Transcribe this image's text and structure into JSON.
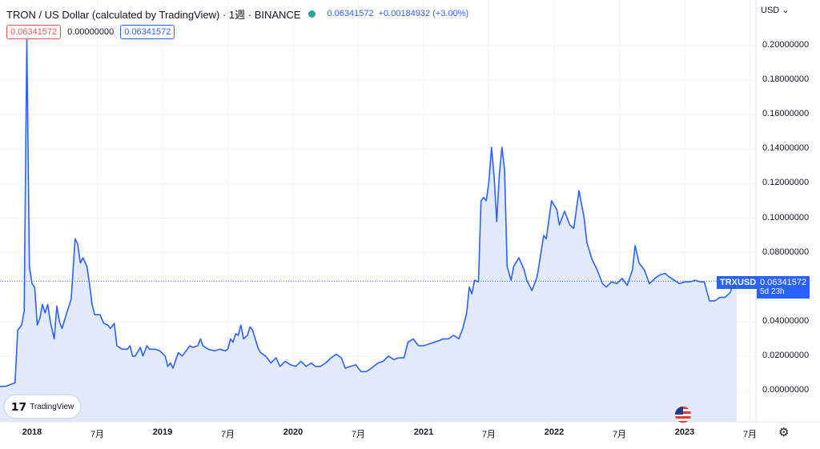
{
  "header": {
    "title": "TRON / US Dollar (calculated by TradingView) · 1週 · BINANCE",
    "last_price": "0.06341572",
    "change": "+0.00184932 (+3.00%)"
  },
  "values_row": {
    "low": "0.06341572",
    "mid": "0.00000000",
    "close": "0.06341572"
  },
  "currency_button": "USD",
  "ticker_label": "TRXUSD",
  "price_label": {
    "price": "0.06341572",
    "countdown": "5d 23h"
  },
  "logo_text": "TradingView",
  "colors": {
    "line": "#2962ff",
    "fill": "#dde6fb",
    "grid": "#f0f3fa"
  },
  "chart_data": {
    "type": "area",
    "title": "TRON / US Dollar (calculated by TradingView) · 1週 · BINANCE",
    "xlabel": "",
    "ylabel": "",
    "ylim": [
      -0.005,
      0.205
    ],
    "grid": true,
    "x_ticks": [
      {
        "label": "2018",
        "t": 2018.0,
        "bold": true
      },
      {
        "label": "7月",
        "t": 2018.5,
        "bold": false
      },
      {
        "label": "2019",
        "t": 2019.0,
        "bold": true
      },
      {
        "label": "7月",
        "t": 2019.5,
        "bold": false
      },
      {
        "label": "2020",
        "t": 2020.0,
        "bold": true
      },
      {
        "label": "7月",
        "t": 2020.5,
        "bold": false
      },
      {
        "label": "2021",
        "t": 2021.0,
        "bold": true
      },
      {
        "label": "7月",
        "t": 2021.5,
        "bold": false
      },
      {
        "label": "2022",
        "t": 2022.0,
        "bold": true
      },
      {
        "label": "7月",
        "t": 2022.5,
        "bold": false
      },
      {
        "label": "2023",
        "t": 2023.0,
        "bold": true
      },
      {
        "label": "7月",
        "t": 2023.5,
        "bold": false
      }
    ],
    "y_ticks": [
      {
        "label": "0.00000000",
        "v": 0.0
      },
      {
        "label": "0.02000000",
        "v": 0.02
      },
      {
        "label": "0.04000000",
        "v": 0.04
      },
      {
        "label": "0.06000000",
        "v": 0.06
      },
      {
        "label": "0.08000000",
        "v": 0.08
      },
      {
        "label": "0.10000000",
        "v": 0.1
      },
      {
        "label": "0.12000000",
        "v": 0.12
      },
      {
        "label": "0.14000000",
        "v": 0.14
      },
      {
        "label": "0.16000000",
        "v": 0.16
      },
      {
        "label": "0.18000000",
        "v": 0.18
      },
      {
        "label": "0.20000000",
        "v": 0.2
      }
    ],
    "series": [
      {
        "name": "TRXUSD",
        "points": [
          [
            2017.72,
            0.0023
          ],
          [
            2017.8,
            0.0025
          ],
          [
            2017.87,
            0.0045
          ],
          [
            2017.89,
            0.035
          ],
          [
            2017.92,
            0.038
          ],
          [
            2017.94,
            0.046
          ],
          [
            2017.96,
            0.205
          ],
          [
            2017.98,
            0.072
          ],
          [
            2018.0,
            0.062
          ],
          [
            2018.02,
            0.06
          ],
          [
            2018.04,
            0.038
          ],
          [
            2018.06,
            0.042
          ],
          [
            2018.08,
            0.05
          ],
          [
            2018.1,
            0.045
          ],
          [
            2018.12,
            0.05
          ],
          [
            2018.14,
            0.04
          ],
          [
            2018.17,
            0.03
          ],
          [
            2018.19,
            0.049
          ],
          [
            2018.21,
            0.04
          ],
          [
            2018.23,
            0.036
          ],
          [
            2018.27,
            0.046
          ],
          [
            2018.3,
            0.053
          ],
          [
            2018.33,
            0.088
          ],
          [
            2018.35,
            0.085
          ],
          [
            2018.37,
            0.074
          ],
          [
            2018.39,
            0.077
          ],
          [
            2018.42,
            0.072
          ],
          [
            2018.44,
            0.062
          ],
          [
            2018.46,
            0.05
          ],
          [
            2018.48,
            0.044
          ],
          [
            2018.52,
            0.044
          ],
          [
            2018.55,
            0.039
          ],
          [
            2018.58,
            0.038
          ],
          [
            2018.6,
            0.036
          ],
          [
            2018.63,
            0.039
          ],
          [
            2018.65,
            0.026
          ],
          [
            2018.69,
            0.024
          ],
          [
            2018.73,
            0.024
          ],
          [
            2018.75,
            0.026
          ],
          [
            2018.77,
            0.02
          ],
          [
            2018.79,
            0.02
          ],
          [
            2018.83,
            0.025
          ],
          [
            2018.85,
            0.02
          ],
          [
            2018.88,
            0.026
          ],
          [
            2018.9,
            0.024
          ],
          [
            2018.94,
            0.024
          ],
          [
            2018.98,
            0.023
          ],
          [
            2019.02,
            0.02
          ],
          [
            2019.04,
            0.014
          ],
          [
            2019.06,
            0.016
          ],
          [
            2019.08,
            0.013
          ],
          [
            2019.12,
            0.022
          ],
          [
            2019.15,
            0.02
          ],
          [
            2019.19,
            0.024
          ],
          [
            2019.21,
            0.026
          ],
          [
            2019.23,
            0.025
          ],
          [
            2019.27,
            0.026
          ],
          [
            2019.29,
            0.03
          ],
          [
            2019.31,
            0.026
          ],
          [
            2019.35,
            0.024
          ],
          [
            2019.4,
            0.023
          ],
          [
            2019.44,
            0.024
          ],
          [
            2019.48,
            0.023
          ],
          [
            2019.5,
            0.024
          ],
          [
            2019.52,
            0.03
          ],
          [
            2019.54,
            0.028
          ],
          [
            2019.56,
            0.033
          ],
          [
            2019.58,
            0.032
          ],
          [
            2019.6,
            0.038
          ],
          [
            2019.62,
            0.03
          ],
          [
            2019.65,
            0.032
          ],
          [
            2019.67,
            0.037
          ],
          [
            2019.69,
            0.035
          ],
          [
            2019.73,
            0.025
          ],
          [
            2019.75,
            0.022
          ],
          [
            2019.79,
            0.02
          ],
          [
            2019.83,
            0.016
          ],
          [
            2019.87,
            0.019
          ],
          [
            2019.9,
            0.014
          ],
          [
            2019.94,
            0.017
          ],
          [
            2019.98,
            0.015
          ],
          [
            2020.02,
            0.014
          ],
          [
            2020.06,
            0.017
          ],
          [
            2020.1,
            0.014
          ],
          [
            2020.14,
            0.016
          ],
          [
            2020.17,
            0.014
          ],
          [
            2020.21,
            0.014
          ],
          [
            2020.25,
            0.016
          ],
          [
            2020.29,
            0.019
          ],
          [
            2020.33,
            0.021
          ],
          [
            2020.37,
            0.019
          ],
          [
            2020.4,
            0.013
          ],
          [
            2020.44,
            0.014
          ],
          [
            2020.48,
            0.015
          ],
          [
            2020.52,
            0.011
          ],
          [
            2020.56,
            0.011
          ],
          [
            2020.6,
            0.013
          ],
          [
            2020.65,
            0.016
          ],
          [
            2020.69,
            0.017
          ],
          [
            2020.73,
            0.02
          ],
          [
            2020.77,
            0.018
          ],
          [
            2020.81,
            0.019
          ],
          [
            2020.85,
            0.019
          ],
          [
            2020.88,
            0.028
          ],
          [
            2020.92,
            0.03
          ],
          [
            2020.96,
            0.026
          ],
          [
            2021.0,
            0.026
          ],
          [
            2021.04,
            0.027
          ],
          [
            2021.08,
            0.028
          ],
          [
            2021.12,
            0.029
          ],
          [
            2021.15,
            0.03
          ],
          [
            2021.19,
            0.03
          ],
          [
            2021.23,
            0.032
          ],
          [
            2021.27,
            0.03
          ],
          [
            2021.3,
            0.036
          ],
          [
            2021.33,
            0.045
          ],
          [
            2021.35,
            0.06
          ],
          [
            2021.37,
            0.056
          ],
          [
            2021.39,
            0.064
          ],
          [
            2021.42,
            0.063
          ],
          [
            2021.44,
            0.11
          ],
          [
            2021.46,
            0.112
          ],
          [
            2021.48,
            0.11
          ],
          [
            2021.5,
            0.121
          ],
          [
            2021.52,
            0.141
          ],
          [
            2021.54,
            0.124
          ],
          [
            2021.56,
            0.098
          ],
          [
            2021.58,
            0.125
          ],
          [
            2021.6,
            0.141
          ],
          [
            2021.62,
            0.128
          ],
          [
            2021.64,
            0.072
          ],
          [
            2021.67,
            0.064
          ],
          [
            2021.69,
            0.072
          ],
          [
            2021.73,
            0.077
          ],
          [
            2021.77,
            0.07
          ],
          [
            2021.79,
            0.064
          ],
          [
            2021.83,
            0.058
          ],
          [
            2021.87,
            0.066
          ],
          [
            2021.92,
            0.09
          ],
          [
            2021.94,
            0.088
          ],
          [
            2021.98,
            0.11
          ],
          [
            2022.02,
            0.105
          ],
          [
            2022.04,
            0.096
          ],
          [
            2022.08,
            0.104
          ],
          [
            2022.12,
            0.096
          ],
          [
            2022.15,
            0.094
          ],
          [
            2022.19,
            0.116
          ],
          [
            2022.23,
            0.1
          ],
          [
            2022.25,
            0.086
          ],
          [
            2022.29,
            0.076
          ],
          [
            2022.33,
            0.07
          ],
          [
            2022.37,
            0.062
          ],
          [
            2022.4,
            0.06
          ],
          [
            2022.44,
            0.063
          ],
          [
            2022.48,
            0.062
          ],
          [
            2022.52,
            0.065
          ],
          [
            2022.56,
            0.061
          ],
          [
            2022.6,
            0.07
          ],
          [
            2022.62,
            0.084
          ],
          [
            2022.65,
            0.074
          ],
          [
            2022.69,
            0.07
          ],
          [
            2022.73,
            0.062
          ],
          [
            2022.77,
            0.065
          ],
          [
            2022.81,
            0.067
          ],
          [
            2022.85,
            0.068
          ],
          [
            2022.88,
            0.066
          ],
          [
            2022.92,
            0.064
          ],
          [
            2022.96,
            0.062
          ],
          [
            2023.0,
            0.063
          ],
          [
            2023.04,
            0.063
          ],
          [
            2023.08,
            0.064
          ],
          [
            2023.12,
            0.063
          ],
          [
            2023.15,
            0.063
          ],
          [
            2023.19,
            0.052
          ],
          [
            2023.23,
            0.052
          ],
          [
            2023.27,
            0.054
          ],
          [
            2023.31,
            0.054
          ],
          [
            2023.35,
            0.057
          ],
          [
            2023.37,
            0.062
          ],
          [
            2023.4,
            0.0634
          ]
        ]
      }
    ]
  }
}
